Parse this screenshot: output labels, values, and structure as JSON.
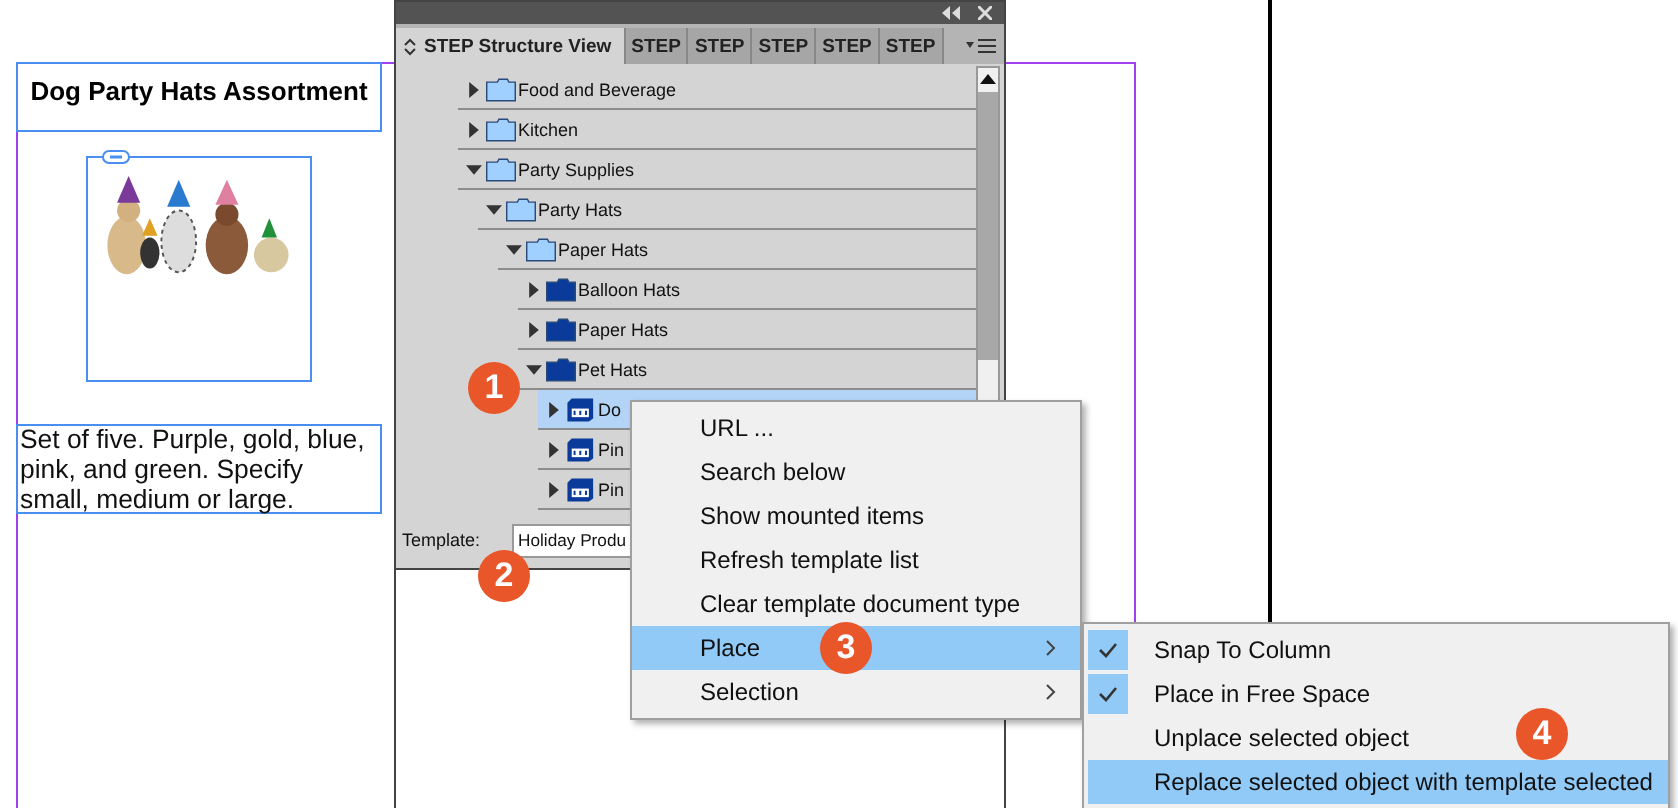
{
  "document": {
    "title": "Dog Party Hats Assortment",
    "description": "Set of five. Purple, gold, blue, pink, and green. Specify small, medium or large."
  },
  "panel": {
    "tabs": [
      {
        "label": "STEP Structure View",
        "selected": true
      },
      {
        "label": "STEP",
        "selected": false
      },
      {
        "label": "STEP",
        "selected": false
      },
      {
        "label": "STEP",
        "selected": false
      },
      {
        "label": "STEP",
        "selected": false
      },
      {
        "label": "STEP",
        "selected": false
      }
    ],
    "tree": [
      {
        "label": "Food and Beverage",
        "kind": "category",
        "expanded": false,
        "selected": false
      },
      {
        "label": "Kitchen",
        "kind": "category",
        "expanded": false,
        "selected": false
      },
      {
        "label": "Party Supplies",
        "kind": "category",
        "expanded": true,
        "selected": false,
        "children": [
          {
            "label": "Party Hats",
            "kind": "category",
            "expanded": true,
            "selected": false,
            "children": [
              {
                "label": "Paper Hats",
                "kind": "category",
                "expanded": true,
                "selected": false,
                "children": [
                  {
                    "label": "Balloon Hats",
                    "kind": "family",
                    "expanded": false,
                    "selected": false
                  },
                  {
                    "label": "Paper Hats",
                    "kind": "family",
                    "expanded": false,
                    "selected": false
                  },
                  {
                    "label": "Pet Hats",
                    "kind": "family",
                    "expanded": true,
                    "selected": false,
                    "children": [
                      {
                        "label": "Do",
                        "kind": "product",
                        "expanded": false,
                        "selected": true
                      },
                      {
                        "label": "Pin",
                        "kind": "product",
                        "expanded": false,
                        "selected": false
                      },
                      {
                        "label": "Pin",
                        "kind": "product",
                        "expanded": false,
                        "selected": false
                      }
                    ]
                  }
                ]
              }
            ]
          }
        ]
      }
    ],
    "template": {
      "label": "Template:",
      "value": "Holiday Produ"
    }
  },
  "context_menu": {
    "items": [
      {
        "label": "URL ...",
        "highlighted": false,
        "submenu": false
      },
      {
        "label": "Search below",
        "highlighted": false,
        "submenu": false
      },
      {
        "label": "Show mounted items",
        "highlighted": false,
        "submenu": false
      },
      {
        "label": "Refresh template list",
        "highlighted": false,
        "submenu": false
      },
      {
        "label": "Clear template document type",
        "highlighted": false,
        "submenu": false
      },
      {
        "label": "Place",
        "highlighted": true,
        "submenu": true
      },
      {
        "label": "Selection",
        "highlighted": false,
        "submenu": true
      }
    ]
  },
  "submenu": {
    "items": [
      {
        "label": "Snap To Column",
        "checked": true,
        "highlighted": false
      },
      {
        "label": "Place in Free Space",
        "checked": true,
        "highlighted": false
      },
      {
        "label": "Unplace selected object",
        "checked": false,
        "highlighted": false
      },
      {
        "label": "Replace selected object with template selected",
        "checked": false,
        "highlighted": true
      }
    ]
  },
  "callouts": [
    "1",
    "2",
    "3",
    "4"
  ]
}
